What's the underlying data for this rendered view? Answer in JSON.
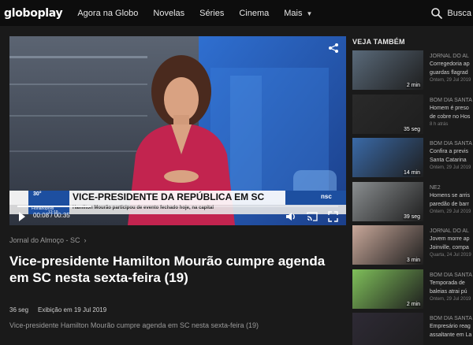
{
  "brand": {
    "logo": "globoplay"
  },
  "nav": {
    "items": [
      "Agora na Globo",
      "Novelas",
      "Séries",
      "Cinema",
      "Mais"
    ],
    "search_label": "Busca"
  },
  "player": {
    "current_time": "00:08",
    "separator": "/",
    "duration": "00:35",
    "progress": 0.23,
    "ticker_headline": "VICE-PRESIDENTE DA REPÚBLICA EM SC",
    "ticker_sub": "Hamilton Mourão participou de evento fechado hoje, na capital",
    "weather_temp": "30°",
    "weather_city": "Florianópolis",
    "weather_time": "12:19",
    "channel_logo": "nsc"
  },
  "video": {
    "breadcrumb": "Jornal do Almoço - SC",
    "title": "Vice-presidente Hamilton Mourão cumpre agenda em SC nesta sexta-feira (19)",
    "duration_label": "36 seg",
    "aired_label": "Exibição em 19 Jul 2019",
    "description": "Vice-presidente Hamilton Mourão cumpre agenda em SC nesta sexta-feira (19)"
  },
  "sidebar": {
    "heading": "VEJA TAMBÉM",
    "items": [
      {
        "program": "JORNAL DO AL",
        "text": [
          "Corregedoria ap",
          "guardas flagrad"
        ],
        "date": "Ontem, 29 Jul 2019",
        "duration": "2 min",
        "thumb_color": "#5a6a7a"
      },
      {
        "program": "BOM DIA SANTA",
        "text": [
          "Homem é preso",
          "de cobre no Hos"
        ],
        "date": "8 h atrás",
        "duration": "35 seg",
        "thumb_color": "#2a2a2a"
      },
      {
        "program": "BOM DIA SANTA",
        "text": [
          "Confira a previs",
          "Santa Catarina"
        ],
        "date": "Ontem, 29 Jul 2019",
        "duration": "14 min",
        "thumb_color": "#3a6aa8"
      },
      {
        "program": "NE2",
        "text": [
          "Homens se arris",
          "paredão de barr"
        ],
        "date": "Ontem, 29 Jul 2019",
        "duration": "39 seg",
        "thumb_color": "#8a8e90"
      },
      {
        "program": "JORNAL DO AL",
        "text": [
          "Jovem morre ap",
          "Joinville, compa"
        ],
        "date": "Quarta, 24 Jul 2019",
        "duration": "3 min",
        "thumb_color": "#c9a89a"
      },
      {
        "program": "BOM DIA SANTA",
        "text": [
          "Temporada de",
          "baleias atrai pú"
        ],
        "date": "Ontem, 29 Jul 2019",
        "duration": "2 min",
        "thumb_color": "#7fbf5a"
      },
      {
        "program": "BOM DIA SANTA",
        "text": [
          "Empresário reag",
          "assaltante em La"
        ],
        "date": "",
        "duration": "",
        "thumb_color": "#2e2a35"
      }
    ]
  },
  "colors": {
    "background": "#1a1a1a",
    "topbar": "#0d0d0d",
    "accent": "#ffffff",
    "muted": "#9a9a9a",
    "ticker_blue": "#1d4fa0"
  }
}
